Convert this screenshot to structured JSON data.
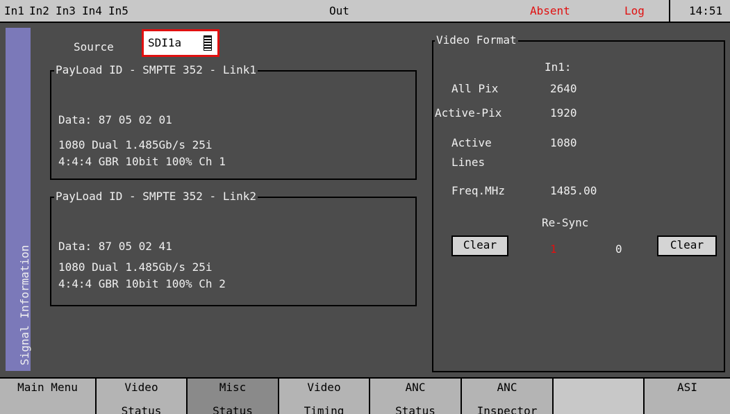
{
  "topbar": {
    "inputs": [
      "In1",
      "In2",
      "In3",
      "In4",
      "In5"
    ],
    "out": "Out",
    "status": "Absent",
    "log": "Log",
    "time": "14:51"
  },
  "sidebar": {
    "label": "Signal Information"
  },
  "source": {
    "label": "Source",
    "value": "SDI1a"
  },
  "link1": {
    "title": "PayLoad ID - SMPTE 352 - Link1",
    "data": "Data: 87 05 02 01",
    "line1": "1080 Dual 1.485Gb/s 25i",
    "line2": "4:4:4 GBR  10bit 100% Ch 1"
  },
  "link2": {
    "title": "PayLoad ID - SMPTE 352 - Link2",
    "data": "Data: 87 05 02 41",
    "line1": "1080 Dual 1.485Gb/s 25i",
    "line2": "4:4:4 GBR  10bit 100% Ch 2"
  },
  "video_format": {
    "title": "Video Format",
    "input_header": "In1:",
    "all_pix_label": "All Pix",
    "all_pix_value": "2640",
    "active_pix_label": "Active-Pix",
    "active_pix_value": "1920",
    "active_lines_label_1": "Active",
    "active_lines_label_2": "Lines",
    "active_lines_value": "1080",
    "freq_label": "Freq.MHz",
    "freq_value": "1485.00",
    "resync_label": "Re-Sync",
    "resync_left_value": "1",
    "resync_right_value": "0",
    "clear_left": "Clear",
    "clear_right": "Clear"
  },
  "menu": [
    {
      "l1": "Main Menu",
      "l2": ""
    },
    {
      "l1": "Video",
      "l2": "Status"
    },
    {
      "l1": "Misc",
      "l2": "Status"
    },
    {
      "l1": "Video",
      "l2": "Timing"
    },
    {
      "l1": "ANC",
      "l2": "Status"
    },
    {
      "l1": "ANC",
      "l2": "Inspector"
    },
    {
      "l1": "",
      "l2": ""
    },
    {
      "l1": "ASI",
      "l2": ""
    }
  ],
  "colors": {
    "accent_red": "#e01010",
    "sidebar": "#7b79b9",
    "background": "#4c4c4c"
  }
}
